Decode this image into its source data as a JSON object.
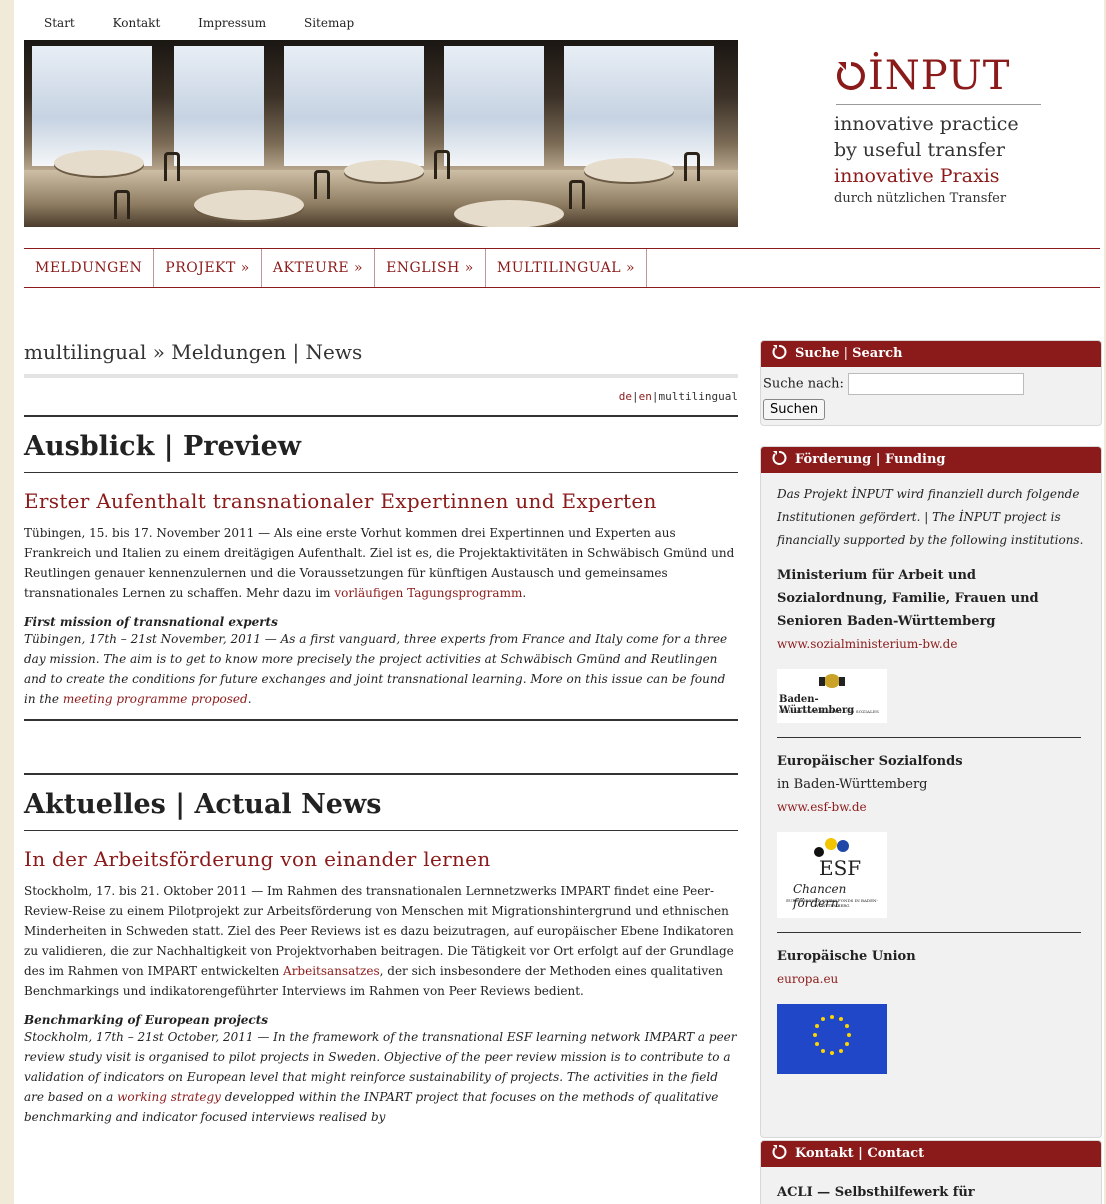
{
  "topnav": [
    "Start",
    "Kontakt",
    "Impressum",
    "Sitemap"
  ],
  "logo": {
    "name": "İNPUT",
    "tag1": "innovative practice",
    "tag2": "by useful transfer",
    "tag3": "innovative Praxis",
    "tag4": "durch nützlichen Transfer"
  },
  "mainnav": [
    "MELDUNGEN",
    "PROJEKT »",
    "AKTEURE »",
    "ENGLISH »",
    "MULTILINGUAL »"
  ],
  "breadcrumb": "multilingual » Meldungen | News",
  "lang": {
    "de": "de",
    "en": "en",
    "multi": "multilingual"
  },
  "preview": {
    "title": "Ausblick | Preview",
    "article_title": "Erster Aufenthalt transnationaler Expertinnen und Experten",
    "body": "Tübingen, 15. bis 17. November 2011 — Als eine erste Vorhut kommen drei Expertinnen und Experten aus Frankreich und Italien zu einem dreitägigen Aufenthalt. Ziel ist es, die Projektaktivitäten in Schwäbisch Gmünd und Reutlingen genauer kennenzulernen und die Voraussetzungen für künftigen Austausch und gemeinsames transnationales Lernen zu schaffen. Mehr dazu im ",
    "body_link": "vorläufigen Tagungsprogramm",
    "body_end": ".",
    "en_title": "First mission of transnational experts",
    "en_body": "Tübingen, 17th – 21st November, 2011 — As a first vanguard, three experts from France and Italy come for a three day mission. The aim is to get to know more precisely the project activities at Schwäbisch Gmünd and Reutlingen and to create the conditions for future exchanges and joint transnational learning. More on this issue can be found in the ",
    "en_link": "meeting programme proposed",
    "en_end": "."
  },
  "news": {
    "title": "Aktuelles | Actual News",
    "article_title": "In der Arbeitsförderung von einander lernen",
    "body": "Stockholm, 17. bis 21. Oktober 2011 — Im Rahmen des transnationalen Lernnetzwerks IMPART findet eine Peer-Review-Reise zu einem Pilotprojekt zur Arbeitsförderung von Menschen mit Migrationshintergrund und ethnischen Minderheiten in Schweden statt. Ziel des Peer Reviews ist es dazu beizutragen, auf europäischer Ebene Indikatoren zu validieren, die zur Nachhaltigkeit von Projektvorhaben beitragen. Die Tätigkeit vor Ort erfolgt auf der Grundlage des im Rahmen von IMPART entwickelten ",
    "body_link": "Arbeitsansatzes",
    "body_end": ", der sich insbesondere der Methoden eines qualitativen Benchmarkings und indikatorengeführter Interviews im Rahmen von Peer Reviews bedient.",
    "en_title": "Benchmarking of European projects",
    "en_body": "Stockholm, 17th – 21st October, 2011 — In the framework of the transnational ESF learning network IMPART a peer review study visit is organised to pilot projects in Sweden. Objective of the peer review mission is to contribute to a validation of indicators on European level that might reinforce sustainability of projects. The activities in the field are based on a ",
    "en_link": "working strategy",
    "en_end": " developped within the INPART project that focuses on the methods of qualitative benchmarking and indicator focused interviews realised by"
  },
  "sidebar": {
    "search": {
      "head_a": "Suche",
      "head_sep": " | ",
      "head_b": "Search",
      "label": "Suche nach:",
      "value": "",
      "button": "Suchen"
    },
    "funding": {
      "head": "Förderung | Funding",
      "intro": "Das Projekt İNPUT wird finanziell durch folgende Institutionen gefördert. | The İNPUT project is financially supported by the following institutions.",
      "org1": "Ministerium für Arbeit und Sozialordnung, Familie, Frauen und Senioren Baden-Württemberg",
      "link1": "www.sozialministerium-bw.de",
      "logo1_name": "Baden-Württemberg",
      "logo1_sub": "MINISTERIUM FÜR ARBEIT UND SOZIALES",
      "org2": "Europäischer Sozialfonds",
      "org2_sub": "in Baden-Württemberg",
      "link2": "www.esf-bw.de",
      "logo2_name": "ESF",
      "logo2_sub": "Chancen fördern",
      "logo2_small": "EUROPÄISCHER SOZIALFONDS IN BADEN-WÜRTTEMBERG",
      "org3": "Europäische Union",
      "link3": "europa.eu"
    },
    "contact": {
      "head": "Kontakt | Contact",
      "org": "ACLI — Selbsthilfewerk für"
    }
  }
}
